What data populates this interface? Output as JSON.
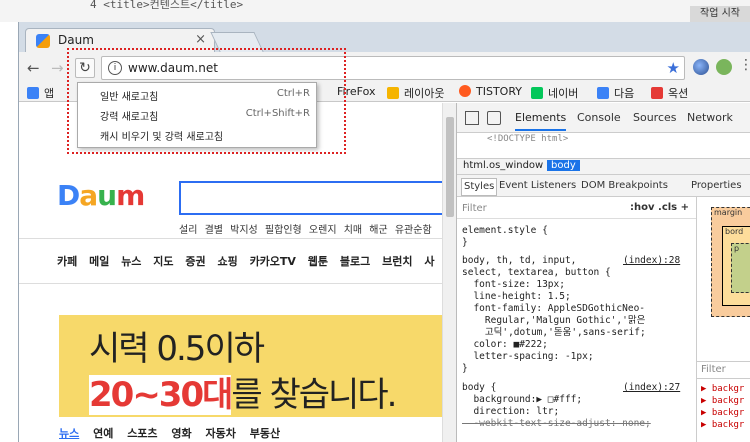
{
  "editor": {
    "code_line": "4      <title>컨텐스트</title>",
    "corner_text": "작업 시작"
  },
  "browser": {
    "tab_title": "Daum",
    "tab_close": "×",
    "url": "www.daum.net",
    "info_glyph": "i",
    "back_glyph": "←",
    "forward_glyph": "→",
    "reload_glyph": "↻",
    "star_glyph": "★",
    "menu_glyph": "⋮"
  },
  "bookmarks": [
    {
      "label": "앱",
      "color": "#3b82f6"
    },
    {
      "label": "FireFox",
      "color": "#ff7f00"
    },
    {
      "label": "레이아웃",
      "color": "#f5b400"
    },
    {
      "label": "TISTORY",
      "color": "#ff5a1f"
    },
    {
      "label": "네이버",
      "color": "#03c75a"
    },
    {
      "label": "다음",
      "color": "#3b82f6"
    },
    {
      "label": "옥션",
      "color": "#e53935"
    }
  ],
  "reload_menu": {
    "items": [
      {
        "label": "일반 새로고침",
        "shortcut": "Ctrl+R"
      },
      {
        "label": "강력 새로고침",
        "shortcut": "Ctrl+Shift+R"
      },
      {
        "label": "캐시 비우기 및 강력 새로고침",
        "shortcut": ""
      }
    ],
    "highlight_color": "#dd2222"
  },
  "page": {
    "logo": [
      "D",
      "a",
      "u",
      "m"
    ],
    "trending": "설리 결별   박지성 필합인형   오렌지 치매   해군 유관순함",
    "menu": [
      "카페",
      "메일",
      "뉴스",
      "지도",
      "증권",
      "쇼핑",
      "카카오TV",
      "웹툰",
      "블로그",
      "브런치",
      "사"
    ],
    "banner_line1": "시력 0.5이하",
    "banner_highlight": "20~30대",
    "banner_line2_rest": "를 찾습니다.",
    "subtabs": [
      "뉴스",
      "연예",
      "스포츠",
      "영화",
      "자동차",
      "부동산"
    ]
  },
  "devtools": {
    "tabs": [
      "Elements",
      "Console",
      "Sources",
      "Network"
    ],
    "html_snippet": "<!DOCTYPE html>",
    "breadcrumbs": [
      "html.os_window",
      "body"
    ],
    "sub_tabs": [
      "Styles",
      "Event Listeners",
      "DOM Breakpoints",
      "Properties"
    ],
    "filter_placeholder": "Filter",
    "filter_opts": ":hov  .cls  +",
    "css": {
      "rule1": "element.style {\n}",
      "rule2_selector": "body, th, td, input,\nselect, textarea, button {",
      "rule2_src": "(index):28",
      "rule2_props": "  font-size: 13px;\n  line-height: 1.5;\n  font-family: AppleSDGothicNeo-\n    Regular,'Malgun Gothic','맑은\n    고딕',dotum,'돋움',sans-serif;\n  color: ■#222;\n  letter-spacing: -1px;\n}",
      "rule3_selector": "body {",
      "rule3_src": "(index):27",
      "rule3_props": "  background:▶ □#fff;\n  direction: ltr;",
      "rule3_strike": "  -webkit-text-size-adjust: none;"
    },
    "box_model": {
      "margin": "margin",
      "border": "bord",
      "padding": "p"
    },
    "computed_filter": "Filter",
    "computed_list": "▶ backgr\n▶ backgr\n▶ backgr\n▶ backgr"
  }
}
